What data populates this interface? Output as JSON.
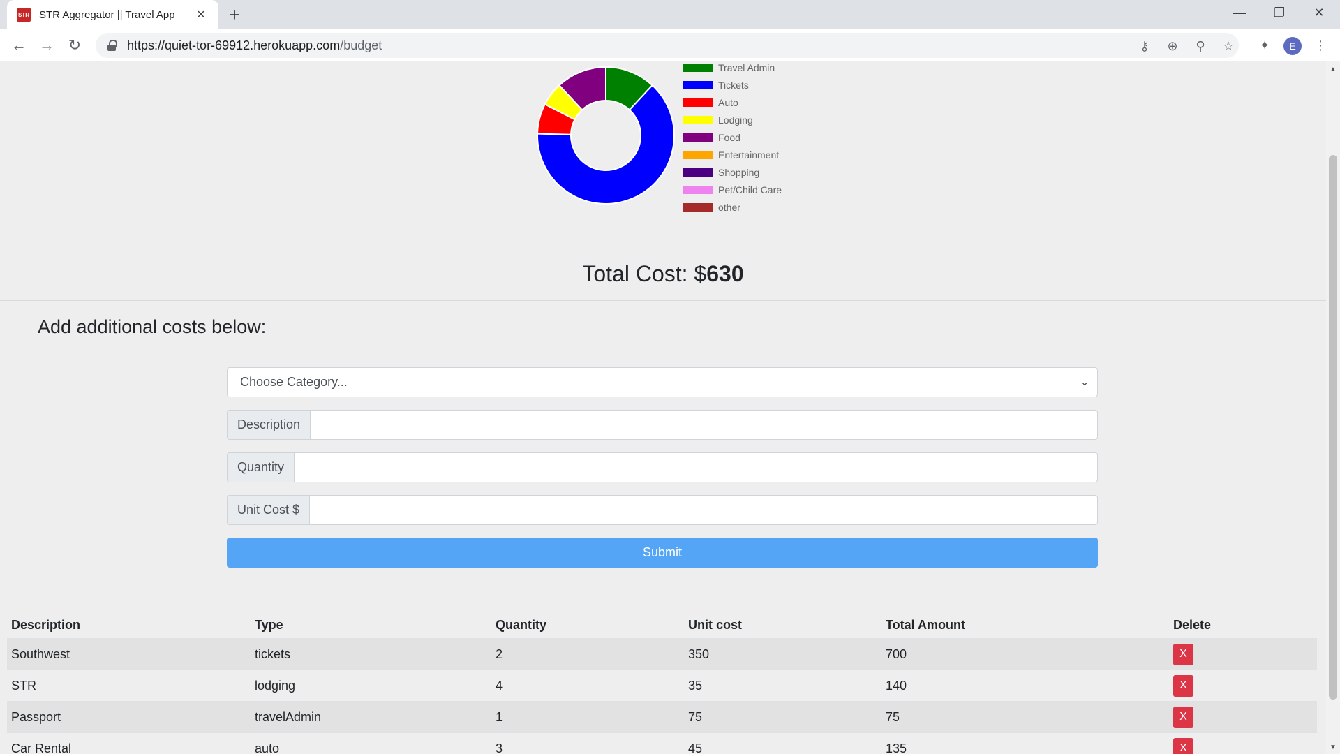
{
  "browser": {
    "tab_title": "STR Aggregator || Travel App",
    "favicon_text": "STR",
    "url_host": "https://quiet-tor-69912.herokuapp.com",
    "url_path": "/budget",
    "profile_initial": "E"
  },
  "chart_data": {
    "type": "doughnut",
    "legend_position": "right",
    "categories": [
      "Travel Admin",
      "Tickets",
      "Auto",
      "Lodging",
      "Food",
      "Entertainment",
      "Shopping",
      "Pet/Child Care",
      "other"
    ],
    "colors": [
      "#008000",
      "#0000ff",
      "#ff0000",
      "#ffff00",
      "#800080",
      "#ffa500",
      "#4b0082",
      "#ee82ee",
      "#a52a2a"
    ],
    "values": [
      75,
      400,
      45,
      35,
      75,
      0,
      0,
      0,
      0
    ]
  },
  "total": {
    "label": "Total Cost: $",
    "value": "630"
  },
  "form": {
    "heading": "Add additional costs below:",
    "category_placeholder": "Choose Category...",
    "description_label": "Description",
    "quantity_label": "Quantity",
    "unit_cost_label": "Unit Cost $",
    "submit_label": "Submit"
  },
  "table": {
    "headers": [
      "Description",
      "Type",
      "Quantity",
      "Unit cost",
      "Total Amount",
      "Delete"
    ],
    "delete_label": "X",
    "rows": [
      [
        "Southwest",
        "tickets",
        "2",
        "350",
        "700"
      ],
      [
        "STR",
        "lodging",
        "4",
        "35",
        "140"
      ],
      [
        "Passport",
        "travelAdmin",
        "1",
        "75",
        "75"
      ],
      [
        "Car Rental",
        "auto",
        "3",
        "45",
        "135"
      ]
    ]
  }
}
